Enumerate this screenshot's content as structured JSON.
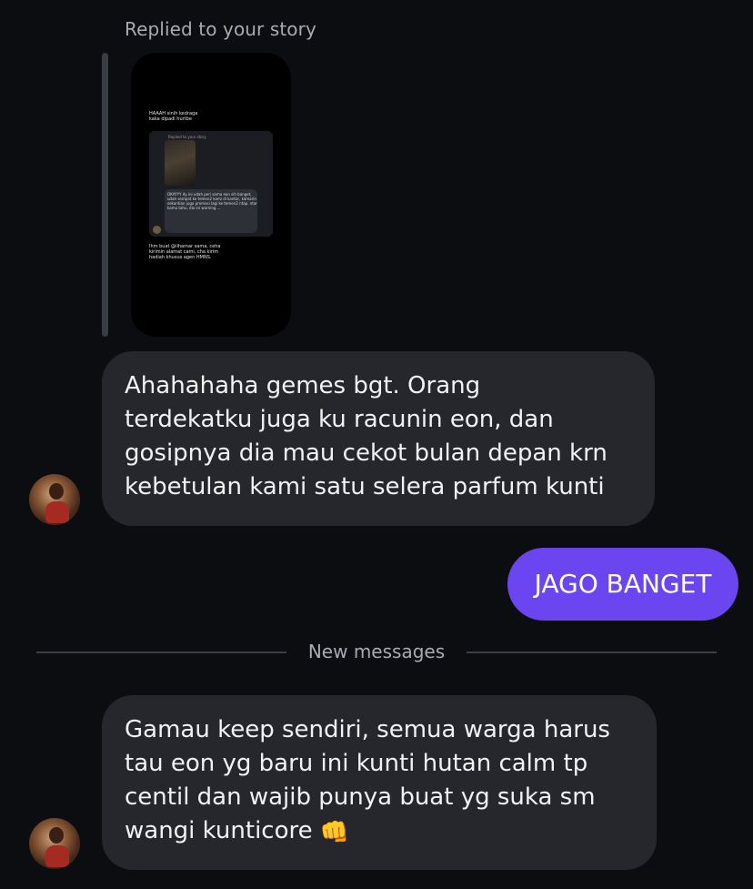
{
  "reply": {
    "caption": "Replied to your story"
  },
  "story_preview": {
    "line_top_1": "HAAAH sinih kedraga",
    "line_top_2": "kaka dipadi hurtbe",
    "card_caption": "Replied to your story",
    "card_text": "OKAYYY dy ini udah peri sama eon sih banget, udah sempat ke temen2 kami di kantor, kamarin sekantian juga promosi lagi ke temen2 ntap. ntar kamu tahu, dia ini warning ...",
    "bottom_1": "Ihm buat @ilhamar sama, ceha",
    "bottom_2": "kirimin alamat cami, cha kirim",
    "bottom_3": "hadiah khusus agen HMNS."
  },
  "messages": [
    {
      "text": "Ahahahaha gemes bgt. Orang\nterdekatku juga ku racunin eon, dan\ngosipnya dia mau cekot bulan depan krn\nkebetulan kami satu selera parfum kunti"
    },
    {
      "text": "JAGO BANGET"
    },
    {
      "text": "Gamau keep sendiri, semua warga harus\ntau eon yg baru ini kunti hutan calm tp\ncentil dan wajib punya buat yg suka sm\nwangi kunticore",
      "emoji": "👊"
    }
  ],
  "divider": {
    "label": "New messages"
  },
  "colors": {
    "background": "#0c0d11",
    "received_bubble": "#26272d",
    "sent_bubble": "#6a45f0",
    "muted_text": "#a8abb3"
  }
}
